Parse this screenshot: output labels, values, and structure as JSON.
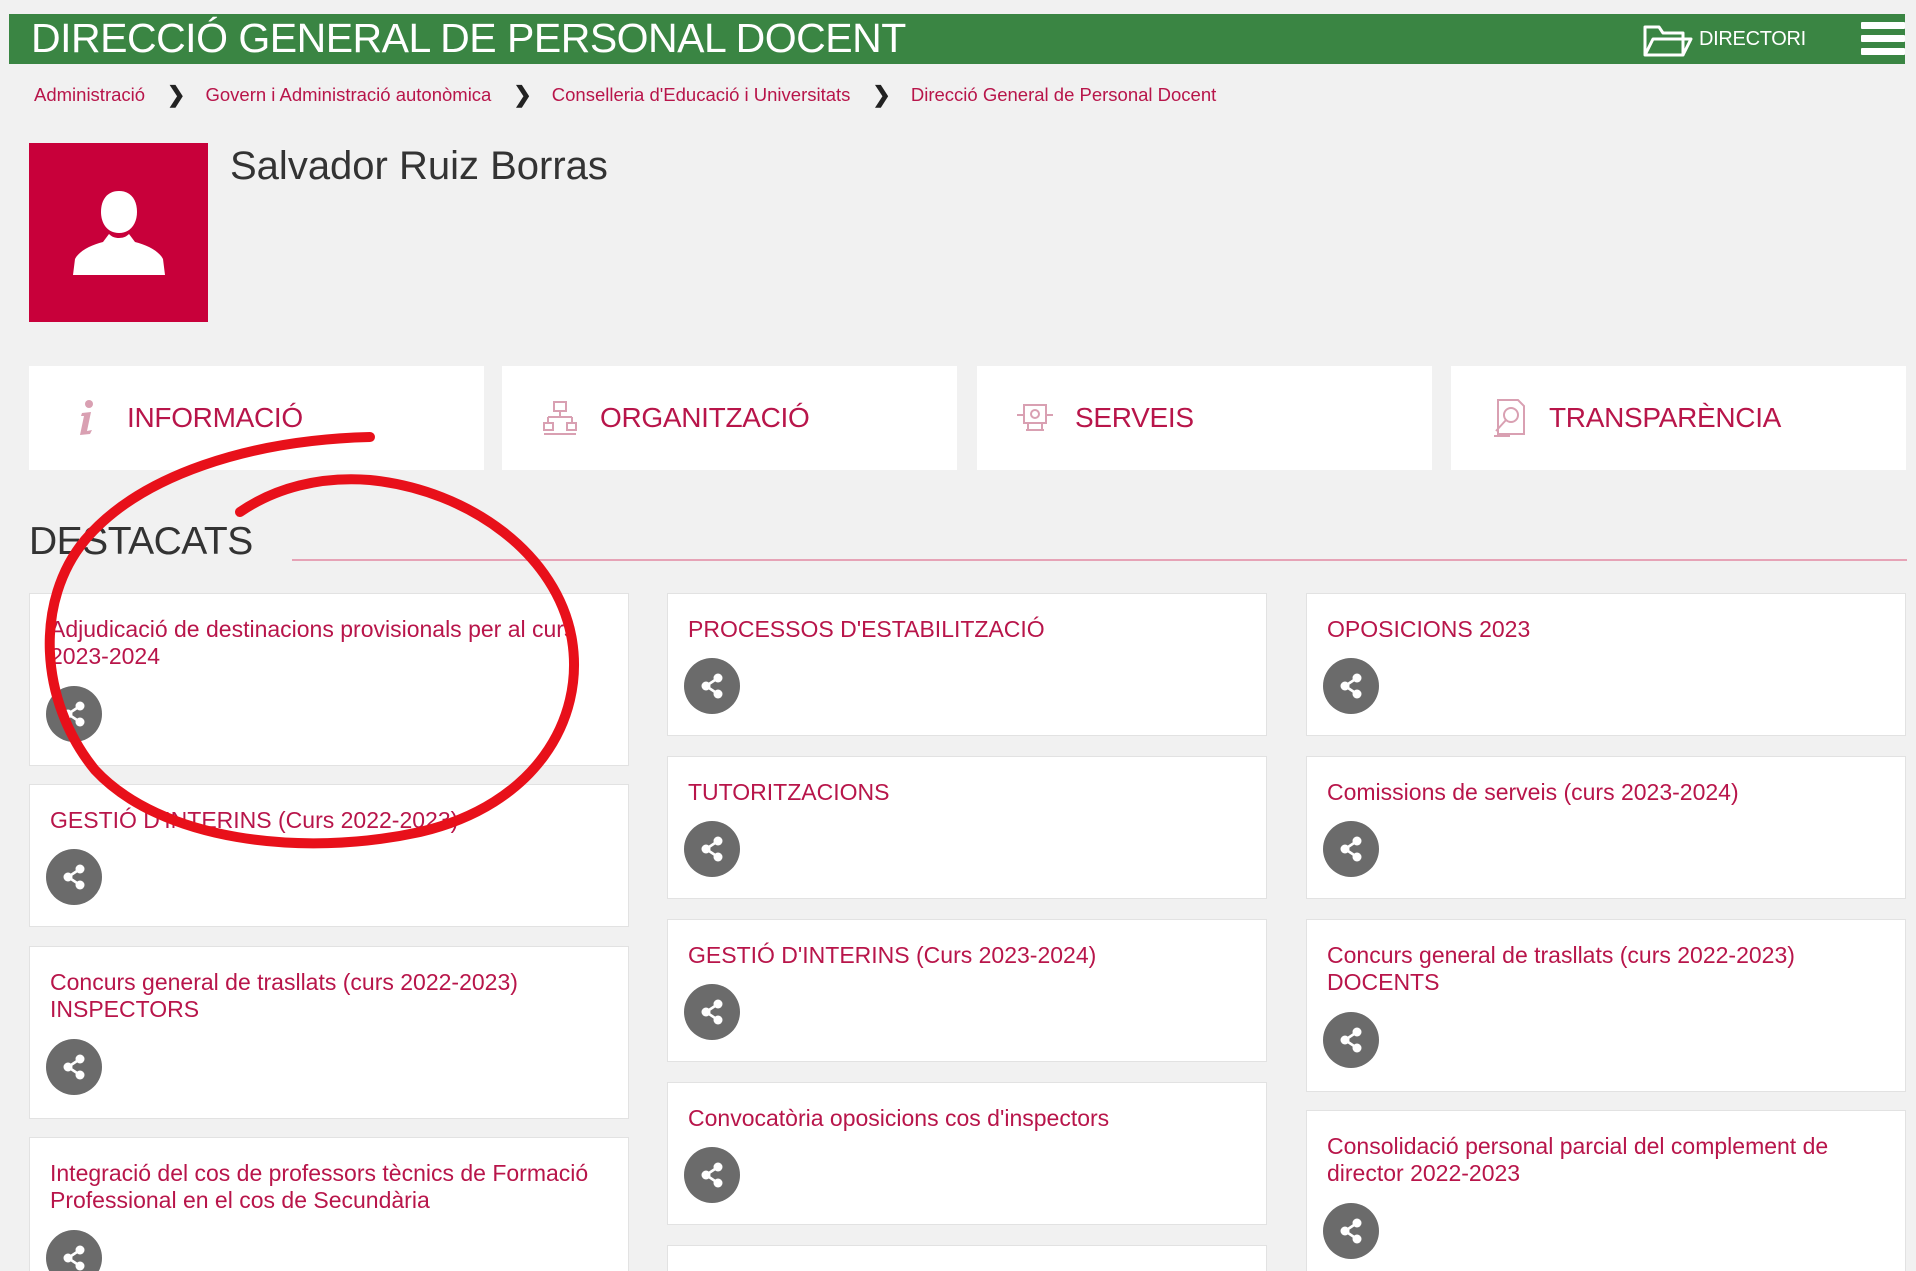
{
  "header": {
    "title": "DIRECCIÓ GENERAL DE PERSONAL DOCENT",
    "directori_label": "DIRECTORI",
    "directori_icon": "folder-icon",
    "menu_icon": "hamburger-menu-icon",
    "bg_color": "#3a8543"
  },
  "breadcrumb": [
    "Administració",
    "Govern i Administració autonòmica",
    "Conselleria d'Educació i Universitats",
    "Direcció General de Personal Docent"
  ],
  "profile": {
    "name": "Salvador Ruiz Borras",
    "avatar_icon": "user-silhouette-icon",
    "avatar_color": "#c8003a"
  },
  "tabs": [
    {
      "label": "INFORMACIÓ",
      "icon": "info-icon"
    },
    {
      "label": "ORGANITZACIÓ",
      "icon": "org-chart-icon"
    },
    {
      "label": "SERVEIS",
      "icon": "services-icon"
    },
    {
      "label": "TRANSPARÈNCIA",
      "icon": "document-search-icon"
    }
  ],
  "section_title": "DESTACATS",
  "cards": {
    "col1": [
      "Adjudicació de destinacions provisionals per al curs 2023-2024",
      "GESTIÓ D'INTERINS (Curs 2022-2023)",
      "Concurs general de trasllats (curs 2022-2023) INSPECTORS",
      "Integració del cos de professors tècnics de Formació Professional en el cos de Secundària"
    ],
    "col2": [
      "PROCESSOS D'ESTABILITZACIÓ",
      "TUTORITZACIONS",
      "GESTIÓ D'INTERINS (Curs 2023-2024)",
      "Convocatòria oposicions cos d'inspectors",
      ""
    ],
    "col3": [
      "OPOSICIONS 2023",
      "Comissions de serveis (curs 2023-2024)",
      "Concurs general de trasllats (curs 2022-2023) DOCENTS",
      "Consolidació personal parcial del complement de director 2022-2023"
    ]
  },
  "share_icon": "share-icon",
  "accent_color": "#b8154a",
  "annotation_color": "#e8101a"
}
